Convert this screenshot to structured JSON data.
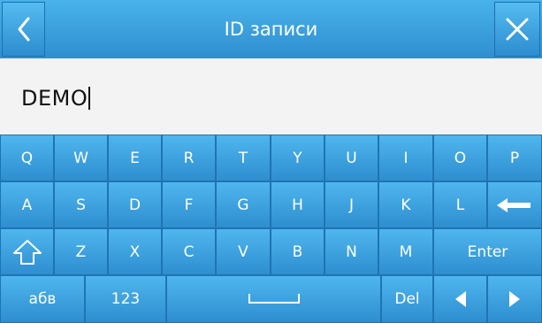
{
  "header": {
    "title": "ID записи",
    "back_icon": "chevron-left-icon",
    "close_icon": "close-icon"
  },
  "input": {
    "value": "DEMO"
  },
  "keyboard": {
    "row1": [
      "Q",
      "W",
      "E",
      "R",
      "T",
      "Y",
      "U",
      "I",
      "O",
      "P"
    ],
    "row2": [
      "A",
      "S",
      "D",
      "F",
      "G",
      "H",
      "J",
      "K",
      "L"
    ],
    "row3": [
      "Z",
      "X",
      "C",
      "V",
      "B",
      "N",
      "M"
    ],
    "enter_label": "Enter",
    "alpha_label": "абв",
    "numeric_label": "123",
    "delete_label": "Del",
    "backspace_icon": "backspace-arrow-icon",
    "shift_icon": "shift-icon",
    "left_icon": "arrow-left-icon",
    "right_icon": "arrow-right-icon"
  },
  "colors": {
    "accent": "#3aa0e0",
    "key_border": "#1f74b3",
    "input_bg": "#f3f3f3"
  }
}
